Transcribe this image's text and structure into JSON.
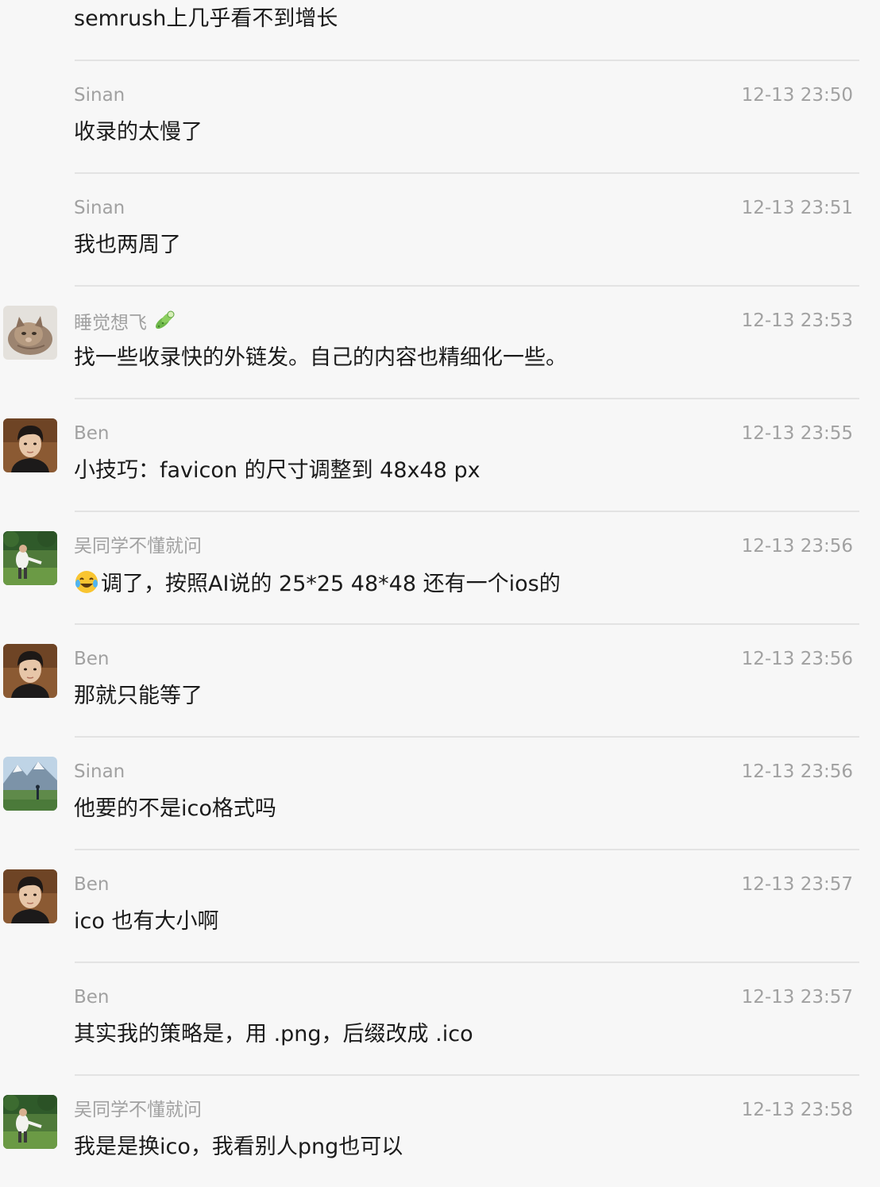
{
  "chat": {
    "top_message": "semrush上几乎看不到增长",
    "messages": [
      {
        "sender": "Sinan",
        "time": "12-13 23:50",
        "text": "收录的太慢了",
        "avatar": ""
      },
      {
        "sender": "Sinan",
        "time": "12-13 23:51",
        "text": "我也两周了",
        "avatar": ""
      },
      {
        "sender": "睡觉想飞",
        "time": "12-13 23:53",
        "text": "找一些收录快的外链发。自己的内容也精细化一些。",
        "avatar": "cat-avatar",
        "badge": "cucumber-icon"
      },
      {
        "sender": "Ben",
        "time": "12-13 23:55",
        "text": "小技巧：favicon  的尺寸调整到 48x48 px",
        "avatar": "man-portrait-avatar"
      },
      {
        "sender": "吴同学不懂就问",
        "time": "12-13 23:56",
        "text": "调了，按照AI说的  25*25  48*48 还有一个ios的",
        "avatar": "person-in-field-avatar",
        "emoji": "crying-laughing-emoji"
      },
      {
        "sender": "Ben",
        "time": "12-13 23:56",
        "text": "那就只能等了",
        "avatar": "man-portrait-avatar"
      },
      {
        "sender": "Sinan",
        "time": "12-13 23:56",
        "text": "他要的不是ico格式吗",
        "avatar": "mountain-landscape-avatar"
      },
      {
        "sender": "Ben",
        "time": "12-13 23:57",
        "text": "ico 也有大小啊",
        "avatar": "man-portrait-avatar"
      },
      {
        "sender": "Ben",
        "time": "12-13 23:57",
        "text": "其实我的策略是，用 .png，后缀改成 .ico",
        "avatar": ""
      },
      {
        "sender": "吴同学不懂就问",
        "time": "12-13 23:58",
        "text": "我是是换ico，我看别人png也可以",
        "avatar": "person-in-field-avatar"
      }
    ]
  }
}
